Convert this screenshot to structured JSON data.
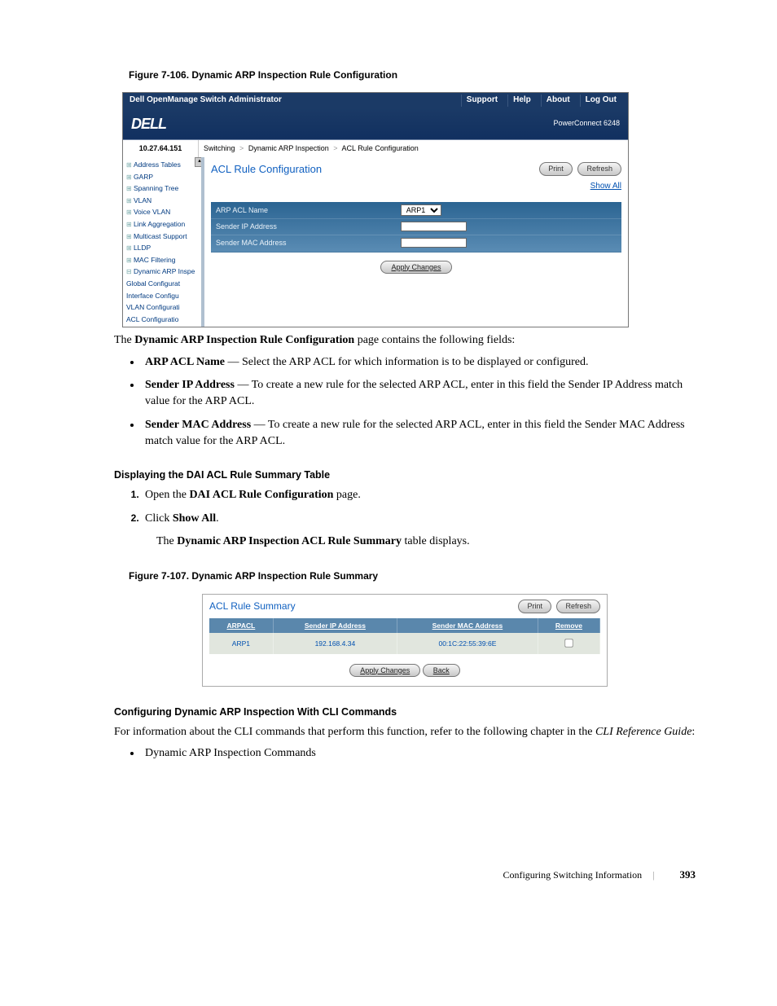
{
  "fig106": {
    "caption": "Figure 7-106.   Dynamic ARP Inspection Rule Configuration",
    "appTitle": "Dell OpenManage Switch Administrator",
    "menu": {
      "support": "Support",
      "help": "Help",
      "about": "About",
      "logout": "Log Out"
    },
    "logo": "DELL",
    "device": "PowerConnect 6248",
    "ip": "10.27.64.151",
    "breadcrumb": {
      "a": "Switching",
      "b": "Dynamic ARP Inspection",
      "c": "ACL Rule Configuration"
    },
    "nav": {
      "items": [
        "Address Tables",
        "GARP",
        "Spanning Tree",
        "VLAN",
        "Voice VLAN",
        "Link Aggregation",
        "Multicast Support",
        "LLDP",
        "MAC Filtering",
        "Dynamic ARP Inspe"
      ],
      "sub": [
        "Global Configurat",
        "Interface Configu",
        "VLAN Configurati",
        "ACL Configuratio"
      ]
    },
    "contentTitle": "ACL Rule Configuration",
    "printBtn": "Print",
    "refreshBtn": "Refresh",
    "showAll": "Show All",
    "fields": {
      "aclName": "ARP ACL Name",
      "aclNameValue": "ARP1",
      "senderIp": "Sender IP Address",
      "senderMac": "Sender MAC Address"
    },
    "apply": "Apply Changes"
  },
  "intro": "The Dynamic ARP Inspection Rule Configuration page contains the following fields:",
  "fields_list": {
    "acl": {
      "label": "ARP ACL Name",
      "desc": " — Select the ARP ACL for which information is to be displayed or configured."
    },
    "ip": {
      "label": "Sender IP Address",
      "desc": " — To create a new rule for the selected ARP ACL, enter in this field the Sender IP Address match value for the ARP ACL."
    },
    "mac": {
      "label": "Sender MAC Address",
      "desc": " — To create a new rule for the selected ARP ACL, enter in this field the Sender MAC Address match value for the ARP ACL."
    }
  },
  "display_heading": "Displaying the DAI ACL Rule Summary Table",
  "steps": {
    "s1a": "Open the ",
    "s1b": "DAI ACL Rule Configuration",
    "s1c": " page.",
    "s2a": "Click ",
    "s2b": "Show All",
    "s2c": ".",
    "s2_suba": "The ",
    "s2_subb": "Dynamic ARP Inspection ACL Rule Summary",
    "s2_subc": " table displays."
  },
  "fig107": {
    "caption": "Figure 7-107.   Dynamic ARP Inspection Rule Summary",
    "title": "ACL Rule Summary",
    "printBtn": "Print",
    "refreshBtn": "Refresh",
    "headers": {
      "a": "ARPACL",
      "b": "Sender IP Address",
      "c": "Sender MAC Address",
      "d": "Remove"
    },
    "row": {
      "a": "ARP1",
      "b": "192.168.4.34",
      "c": "00:1C:22:55:39:6E"
    },
    "apply": "Apply Changes",
    "back": "Back"
  },
  "cli_heading": "Configuring Dynamic ARP Inspection With CLI Commands",
  "cli_text_a": "For information about the CLI commands that perform this function, refer to the following chapter in the ",
  "cli_text_b": "CLI Reference Guide",
  "cli_text_c": ":",
  "cli_bullet": "Dynamic ARP Inspection Commands",
  "footer": {
    "section": "Configuring Switching Information",
    "page": "393"
  }
}
